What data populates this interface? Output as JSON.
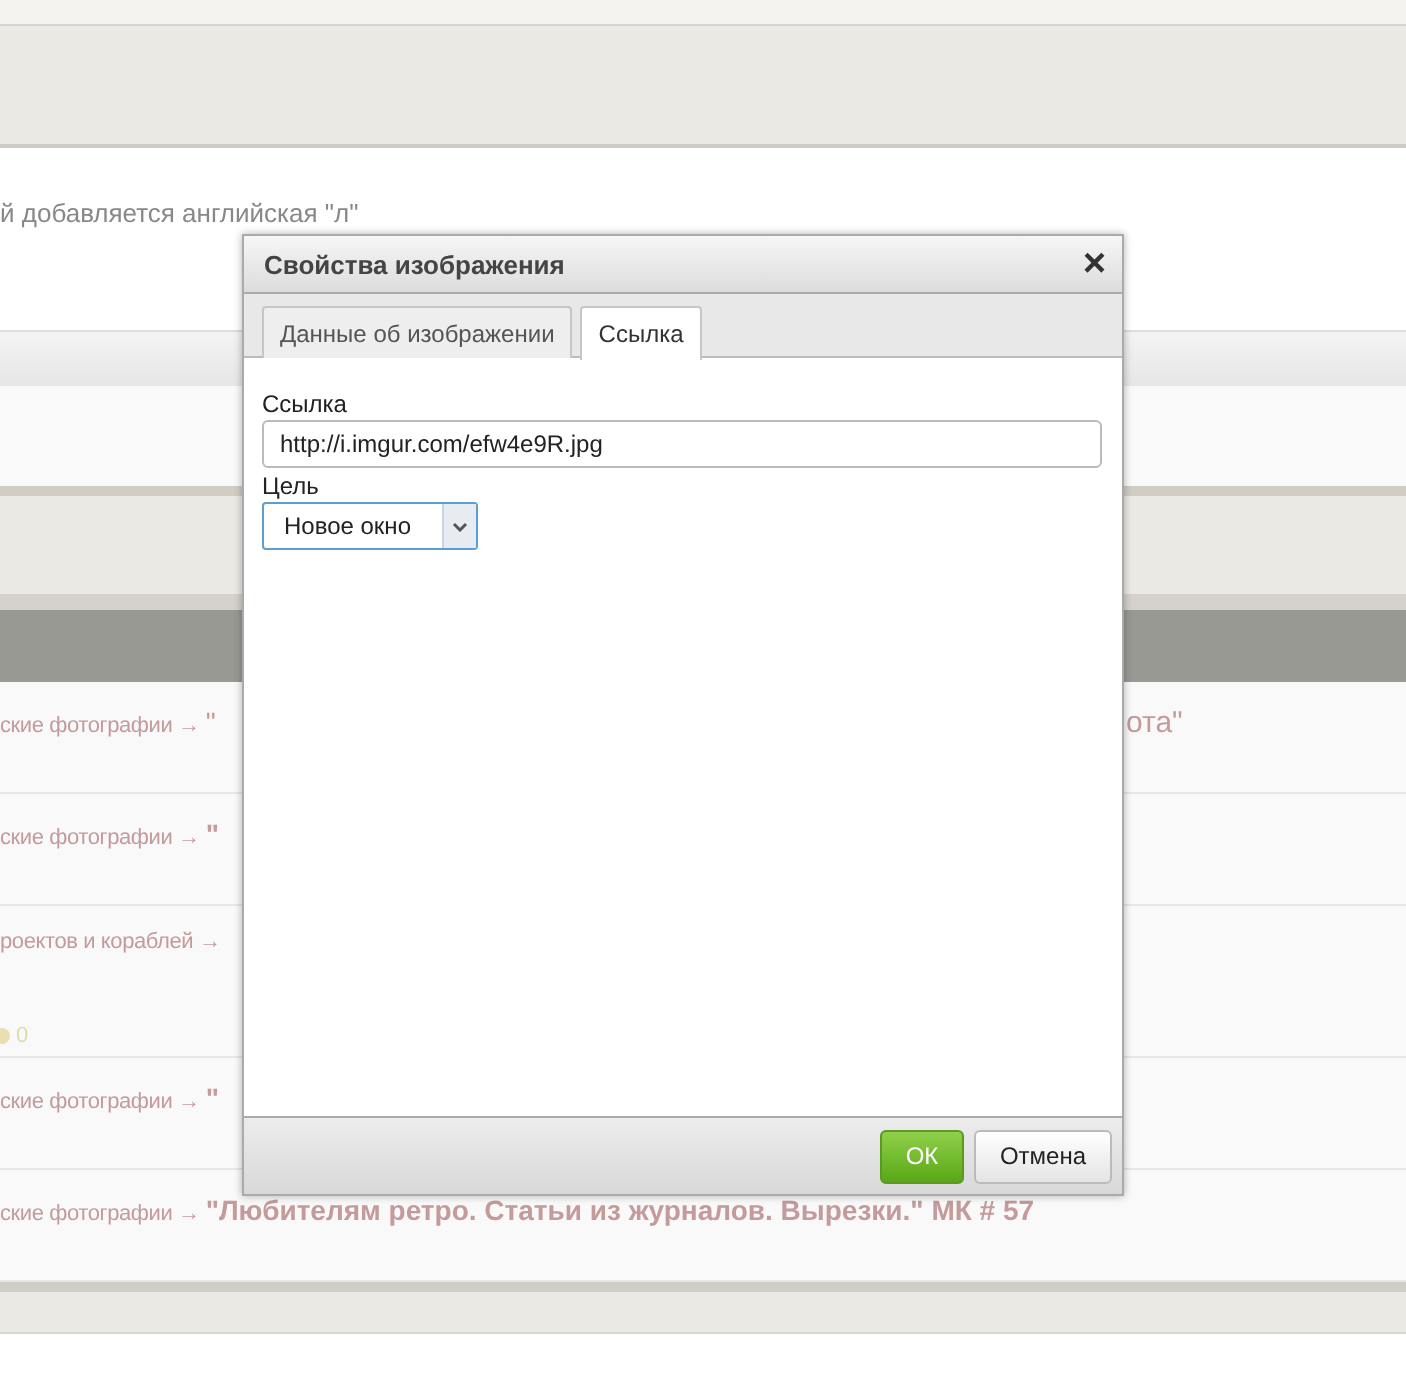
{
  "page": {
    "notice": "й добавляется английская \"л\"",
    "rows": [
      {
        "breadcrumb": "ские фотографии →",
        "title": "\"",
        "title_bold": false,
        "continuation": "ота\""
      },
      {
        "breadcrumb": "ские фотографии →",
        "title": "\"",
        "title_bold": true
      },
      {
        "breadcrumb": "роектов и кораблей →",
        "comments": "0"
      },
      {
        "breadcrumb": "ские фотографии →",
        "title": "\"",
        "title_bold": true
      },
      {
        "breadcrumb": "ские фотографии →",
        "title": "\"Любителям ретро. Статьи из журналов. Вырезки.\" МК # 57",
        "title_bold": true
      }
    ]
  },
  "dialog": {
    "title": "Свойства изображения",
    "close": "×",
    "tabs": [
      {
        "label": "Данные об изображении",
        "selected": false
      },
      {
        "label": "Ссылка",
        "selected": true
      }
    ],
    "fields": [
      {
        "kind": "text",
        "label": "Ссылка",
        "value": "http://i.imgur.com/efw4e9R.jpg"
      },
      {
        "kind": "select",
        "label": "Цель",
        "value": "Новое окно"
      }
    ],
    "buttons": [
      {
        "kind": "primary",
        "label": "ОК"
      },
      {
        "kind": "secondary",
        "label": "Отмена"
      }
    ]
  }
}
